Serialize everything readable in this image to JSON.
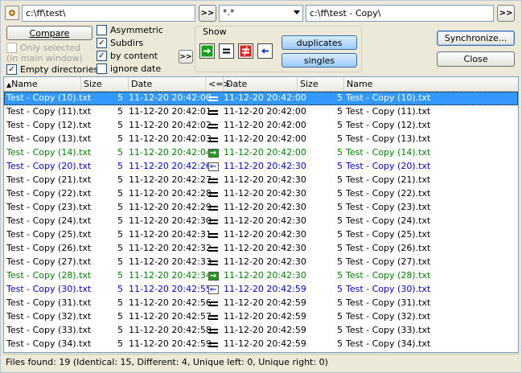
{
  "toolbar": {
    "left_path": "c:\\ff\\test\\",
    "right_path": "c:\\ff\\test - Copy\\",
    "browse_label": ">>",
    "filter": "*.*",
    "compare_label": "Compare",
    "synchronize_label": "Synchronize...",
    "close_label": "Close",
    "expand_label": ">>"
  },
  "options": {
    "only_selected": "Only selected",
    "only_selected_sub": "(in main window)",
    "empty_dirs": "Empty directories",
    "asymmetric": "Asymmetric",
    "subdirs": "Subdirs",
    "by_content": "by content",
    "ignore_date": "ignore date",
    "checks": {
      "only_selected": false,
      "empty_dirs": true,
      "asymmetric": false,
      "subdirs": true,
      "by_content": true,
      "ignore_date": false
    }
  },
  "show": {
    "title": "Show",
    "duplicates_label": "duplicates",
    "singles_label": "singles"
  },
  "columns": [
    "Name",
    "Size",
    "Date",
    "<=>",
    "Date",
    "Size",
    "Name"
  ],
  "rows": [
    {
      "n1": "Test - Copy (10).txt",
      "s1": "5",
      "d1": "11-12-20 20:42:00",
      "cmp": "eq",
      "d2": "11-12-20 20:42:00",
      "s2": "5",
      "n2": "Test - Copy (10).txt",
      "color": "sel"
    },
    {
      "n1": "Test - Copy (11).txt",
      "s1": "5",
      "d1": "11-12-20 20:42:01",
      "cmp": "eq",
      "d2": "11-12-20 20:42:00",
      "s2": "5",
      "n2": "Test - Copy (11).txt",
      "color": "black"
    },
    {
      "n1": "Test - Copy (12).txt",
      "s1": "5",
      "d1": "11-12-20 20:42:02",
      "cmp": "eq",
      "d2": "11-12-20 20:42:00",
      "s2": "5",
      "n2": "Test - Copy (12).txt",
      "color": "black"
    },
    {
      "n1": "Test - Copy (13).txt",
      "s1": "5",
      "d1": "11-12-20 20:42:03",
      "cmp": "eq",
      "d2": "11-12-20 20:42:00",
      "s2": "5",
      "n2": "Test - Copy (13).txt",
      "color": "black"
    },
    {
      "n1": "Test - Copy (14).txt",
      "s1": "5",
      "d1": "11-12-20 20:42:04",
      "cmp": "right",
      "d2": "11-12-20 20:42:00",
      "s2": "5",
      "n2": "Test - Copy (14).txt",
      "color": "green"
    },
    {
      "n1": "Test - Copy (20).txt",
      "s1": "5",
      "d1": "11-12-20 20:42:26",
      "cmp": "left",
      "d2": "11-12-20 20:42:30",
      "s2": "5",
      "n2": "Test - Copy (20).txt",
      "color": "blue"
    },
    {
      "n1": "Test - Copy (21).txt",
      "s1": "5",
      "d1": "11-12-20 20:42:27",
      "cmp": "eq",
      "d2": "11-12-20 20:42:30",
      "s2": "5",
      "n2": "Test - Copy (21).txt",
      "color": "black"
    },
    {
      "n1": "Test - Copy (22).txt",
      "s1": "5",
      "d1": "11-12-20 20:42:28",
      "cmp": "eq",
      "d2": "11-12-20 20:42:30",
      "s2": "5",
      "n2": "Test - Copy (22).txt",
      "color": "black"
    },
    {
      "n1": "Test - Copy (23).txt",
      "s1": "5",
      "d1": "11-12-20 20:42:29",
      "cmp": "eq",
      "d2": "11-12-20 20:42:30",
      "s2": "5",
      "n2": "Test - Copy (23).txt",
      "color": "black"
    },
    {
      "n1": "Test - Copy (24).txt",
      "s1": "5",
      "d1": "11-12-20 20:42:30",
      "cmp": "eq",
      "d2": "11-12-20 20:42:30",
      "s2": "5",
      "n2": "Test - Copy (24).txt",
      "color": "black"
    },
    {
      "n1": "Test - Copy (25).txt",
      "s1": "5",
      "d1": "11-12-20 20:42:31",
      "cmp": "eq",
      "d2": "11-12-20 20:42:30",
      "s2": "5",
      "n2": "Test - Copy (25).txt",
      "color": "black"
    },
    {
      "n1": "Test - Copy (26).txt",
      "s1": "5",
      "d1": "11-12-20 20:42:32",
      "cmp": "eq",
      "d2": "11-12-20 20:42:30",
      "s2": "5",
      "n2": "Test - Copy (26).txt",
      "color": "black"
    },
    {
      "n1": "Test - Copy (27).txt",
      "s1": "5",
      "d1": "11-12-20 20:42:33",
      "cmp": "eq",
      "d2": "11-12-20 20:42:30",
      "s2": "5",
      "n2": "Test - Copy (27).txt",
      "color": "black"
    },
    {
      "n1": "Test - Copy (28).txt",
      "s1": "5",
      "d1": "11-12-20 20:42:34",
      "cmp": "right",
      "d2": "11-12-20 20:42:30",
      "s2": "5",
      "n2": "Test - Copy (28).txt",
      "color": "green"
    },
    {
      "n1": "Test - Copy (30).txt",
      "s1": "5",
      "d1": "11-12-20 20:42:55",
      "cmp": "left",
      "d2": "11-12-20 20:42:59",
      "s2": "5",
      "n2": "Test - Copy (30).txt",
      "color": "blue"
    },
    {
      "n1": "Test - Copy (31).txt",
      "s1": "5",
      "d1": "11-12-20 20:42:56",
      "cmp": "eq",
      "d2": "11-12-20 20:42:59",
      "s2": "5",
      "n2": "Test - Copy (31).txt",
      "color": "black"
    },
    {
      "n1": "Test - Copy (32).txt",
      "s1": "5",
      "d1": "11-12-20 20:42:57",
      "cmp": "eq",
      "d2": "11-12-20 20:42:59",
      "s2": "5",
      "n2": "Test - Copy (32).txt",
      "color": "black"
    },
    {
      "n1": "Test - Copy (33).txt",
      "s1": "5",
      "d1": "11-12-20 20:42:58",
      "cmp": "eq",
      "d2": "11-12-20 20:42:59",
      "s2": "5",
      "n2": "Test - Copy (33).txt",
      "color": "black"
    },
    {
      "n1": "Test - Copy (34).txt",
      "s1": "5",
      "d1": "11-12-20 20:42:59",
      "cmp": "eq",
      "d2": "11-12-20 20:42:59",
      "s2": "5",
      "n2": "Test - Copy (34).txt",
      "color": "black"
    }
  ],
  "status": "Files found: 19  (Identical: 15, Different: 4, Unique left: 0, Unique right: 0)",
  "colors": {
    "selection": "#3399ff",
    "newer_left": "#008000",
    "newer_right": "#0000c8"
  }
}
